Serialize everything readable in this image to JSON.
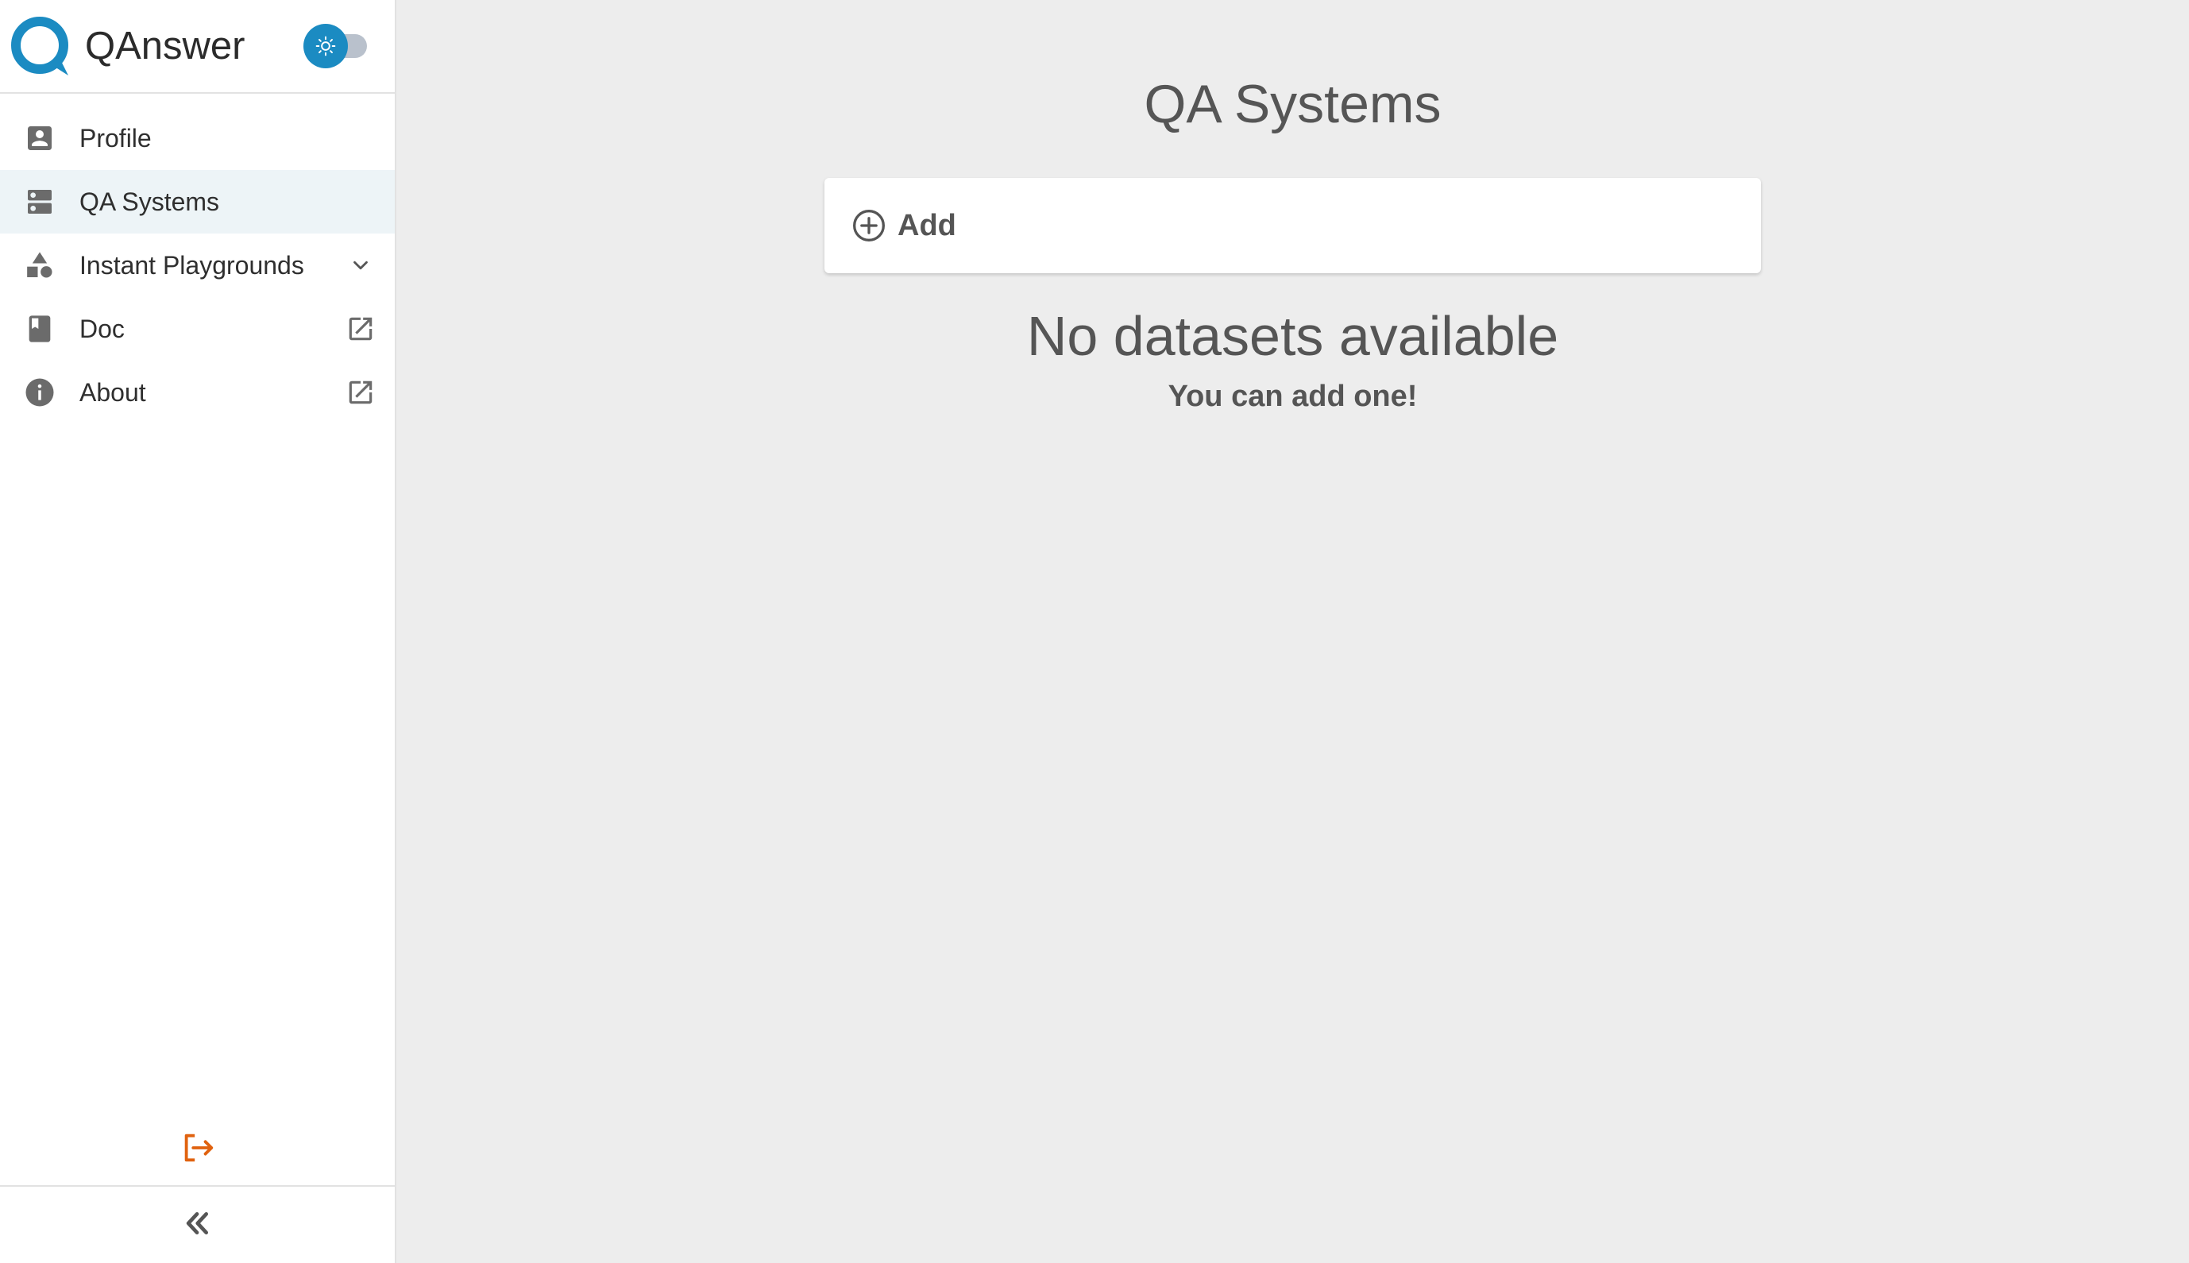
{
  "app": {
    "name": "QAnswer",
    "logo_icon": "qanswer-logo-icon",
    "theme_toggle": {
      "state": "light",
      "icon": "sun-icon"
    }
  },
  "sidebar": {
    "items": [
      {
        "label": "Profile",
        "icon": "account-box-icon",
        "active": false
      },
      {
        "label": "QA Systems",
        "icon": "dns-icon",
        "active": true
      },
      {
        "label": "Instant Playgrounds",
        "icon": "shapes-icon",
        "active": false,
        "trailing": "chevron-down-icon"
      },
      {
        "label": "Doc",
        "icon": "book-icon",
        "active": false,
        "trailing": "open-in-new-icon"
      },
      {
        "label": "About",
        "icon": "info-icon",
        "active": false,
        "trailing": "open-in-new-icon"
      }
    ],
    "logout_icon": "logout-icon",
    "collapse_icon": "double-chevron-left-icon"
  },
  "main": {
    "title": "QA Systems",
    "add_label": "Add",
    "add_icon": "add-circle-icon",
    "empty_title": "No datasets available",
    "empty_subtitle": "You can add one!"
  },
  "colors": {
    "brand": "#1b8bc2",
    "logout": "#e0620f",
    "active_row": "#edf4f7",
    "background": "#ededed"
  }
}
